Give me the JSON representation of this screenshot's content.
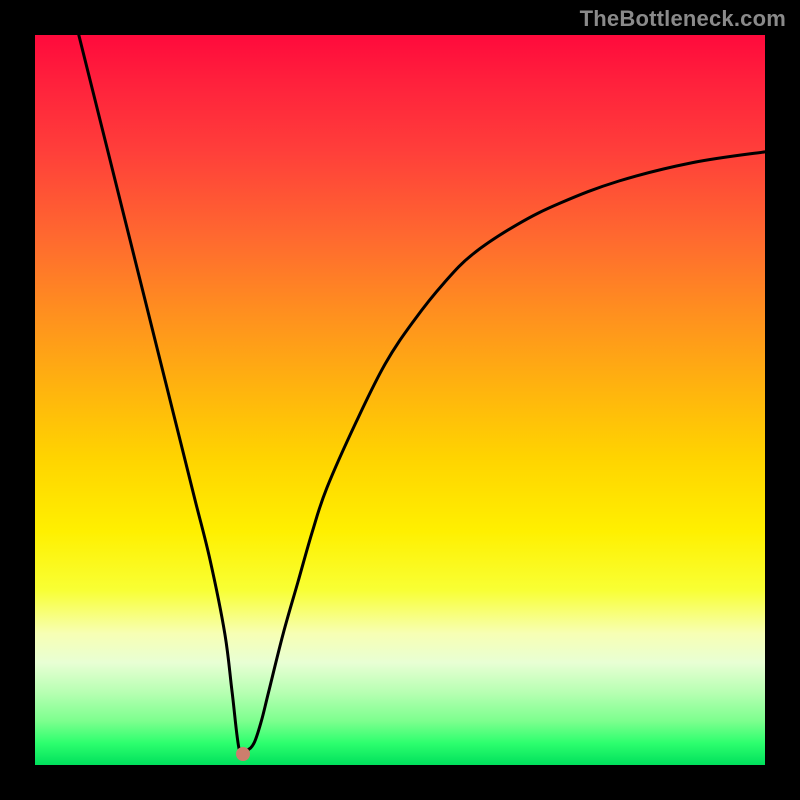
{
  "watermark": "TheBottleneck.com",
  "colors": {
    "background": "#000000",
    "curve": "#000000",
    "marker": "#cd7e6d"
  },
  "chart_data": {
    "type": "line",
    "title": "",
    "xlabel": "",
    "ylabel": "",
    "xlim": [
      0,
      100
    ],
    "ylim": [
      0,
      100
    ],
    "series": [
      {
        "name": "bottleneck-curve",
        "x": [
          6,
          8,
          10,
          12,
          14,
          16,
          18,
          20,
          22,
          24,
          26,
          27,
          28,
          29,
          30,
          31,
          32,
          34,
          36,
          38,
          40,
          44,
          48,
          52,
          56,
          60,
          66,
          72,
          80,
          90,
          100
        ],
        "y": [
          100,
          92,
          84,
          76,
          68,
          60,
          52,
          44,
          36,
          28,
          18,
          10,
          2,
          2,
          3,
          6,
          10,
          18,
          25,
          32,
          38,
          47,
          55,
          61,
          66,
          70,
          74,
          77,
          80,
          82.5,
          84
        ]
      }
    ],
    "markers": [
      {
        "name": "sweet-spot",
        "x": 28.5,
        "y": 1.5
      }
    ],
    "gradient_stops": [
      {
        "pos": 0,
        "color": "#ff0a3c"
      },
      {
        "pos": 50,
        "color": "#ffd400"
      },
      {
        "pos": 80,
        "color": "#f7ffb4"
      },
      {
        "pos": 100,
        "color": "#00e05c"
      }
    ]
  }
}
